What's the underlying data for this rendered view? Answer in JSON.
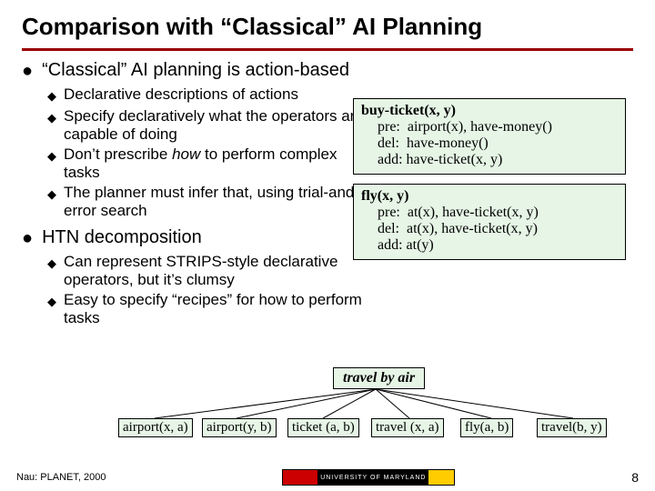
{
  "title": "Comparison with “Classical” AI Planning",
  "sections": [
    {
      "heading": "“Classical” AI planning is action-based",
      "items": [
        "Declarative descriptions of actions",
        "Specify declaratively what the operators are capable of doing",
        "Don’t prescribe how to perform complex tasks",
        "The planner must infer that, using trial-and-error search"
      ]
    },
    {
      "heading": "HTN decomposition",
      "items": [
        "Can represent STRIPS-style declarative operators, but it’s clumsy",
        "Easy to specify “recipes” for how to perform tasks"
      ]
    }
  ],
  "operators": [
    {
      "name": "buy-ticket(x, y)",
      "pre": "airport(x), have-money()",
      "del": "have-money()",
      "add": "have-ticket(x, y)"
    },
    {
      "name": "fly(x, y)",
      "pre": "at(x), have-ticket(x, y)",
      "del": "at(x), have-ticket(x, y)",
      "add": "at(y)"
    }
  ],
  "tree": {
    "root": "travel by air",
    "leaves": [
      "airport(x, a)",
      "airport(y, b)",
      "ticket (a, b)",
      "travel (x, a)",
      "fly(a, b)",
      "travel(b, y)"
    ]
  },
  "footer": {
    "citation": "Nau: PLANET, 2000",
    "org": "UNIVERSITY OF MARYLAND",
    "page": "8"
  }
}
